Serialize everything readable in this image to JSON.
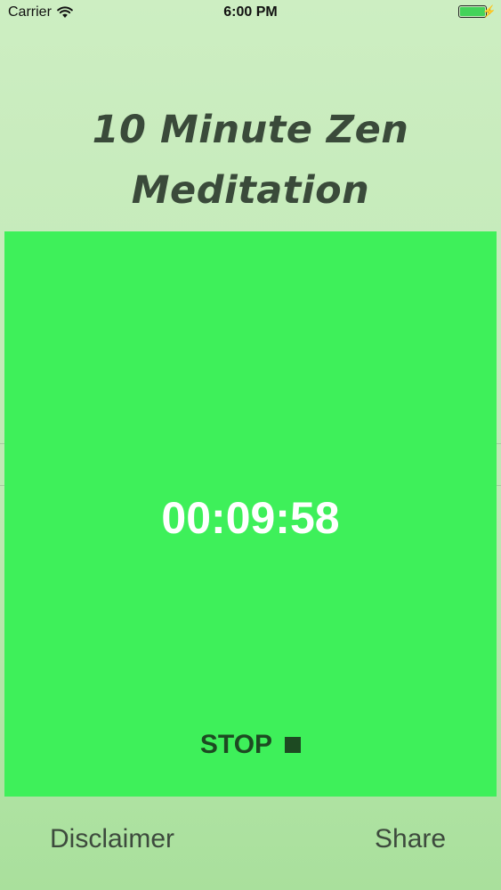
{
  "status_bar": {
    "carrier": "Carrier",
    "time": "6:00 PM",
    "battery_level": 1.0,
    "icons": [
      "wifi-icon",
      "battery-icon",
      "charging-bolt-icon"
    ]
  },
  "app": {
    "title_line1": "10 Minute Zen",
    "title_line2": "Meditation",
    "timer": "00:09:58",
    "stop_label": "STOP",
    "disclaimer_label": "Disclaimer",
    "share_label": "Share"
  },
  "colors": {
    "background": "#c5ebba",
    "timer_panel": "#3ef05a",
    "timer_text": "#ffffff",
    "stop_text": "#1d4a22",
    "title_text": "#3a4a3a"
  }
}
